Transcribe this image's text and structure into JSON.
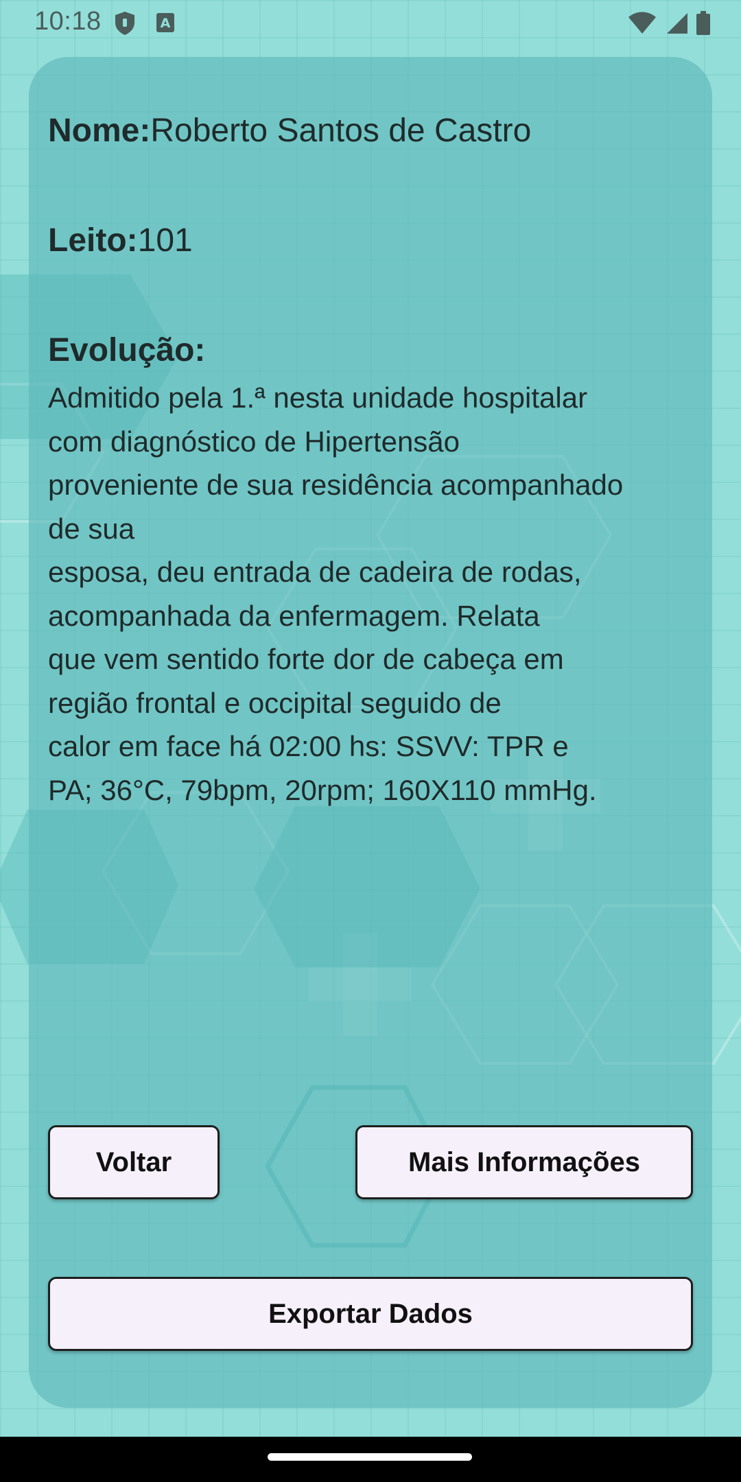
{
  "status_bar": {
    "time": "10:18",
    "left_icons": [
      "shield-icon",
      "font-a-icon"
    ],
    "right_icons": [
      "wifi-icon",
      "signal-icon",
      "battery-icon"
    ]
  },
  "patient": {
    "name_label": "Nome:",
    "name_value": "Roberto Santos de Castro",
    "bed_label": "Leito:",
    "bed_value": "101",
    "evolution_label": "Evolução:",
    "evolution_text": "Admitido pela 1.ª nesta unidade hospitalar\ncom diagnóstico de Hipertensão\nproveniente de sua residência acompanhado\nde sua\nesposa, deu entrada de cadeira de rodas,\nacompanhada da enfermagem. Relata\nque vem sentido forte dor de cabeça em\nregião frontal e occipital seguido de\ncalor em face há 02:00 hs: SSVV: TPR e\nPA; 36°C, 79bpm, 20rpm; 160X110 mmHg."
  },
  "buttons": {
    "back": "Voltar",
    "more_info": "Mais Informações",
    "export": "Exportar Dados"
  },
  "colors": {
    "background": "#93ded8",
    "card": "#5cb6ba",
    "button_fill": "#f6f0fb",
    "button_border": "#1e1e1e"
  }
}
